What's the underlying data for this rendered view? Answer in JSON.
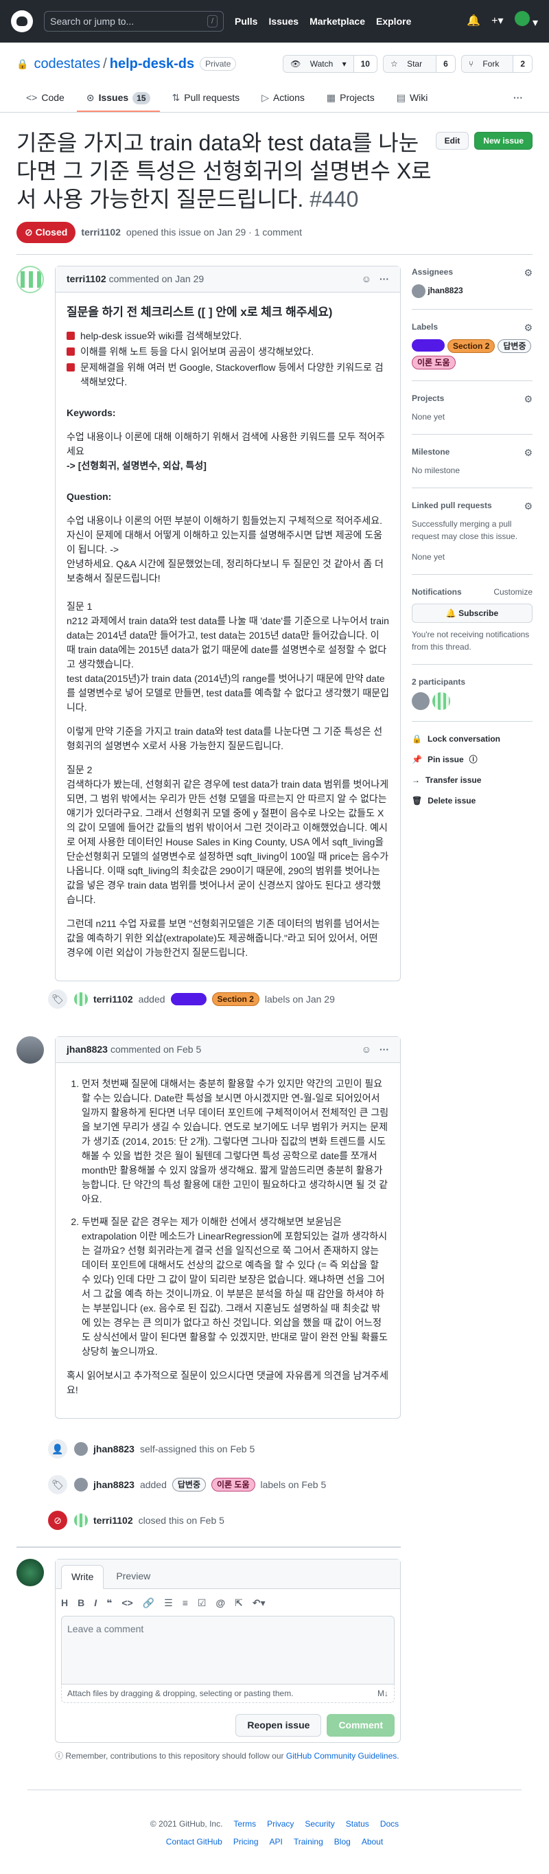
{
  "header": {
    "search_placeholder": "Search or jump to...",
    "slash": "/",
    "nav": [
      "Pulls",
      "Issues",
      "Marketplace",
      "Explore"
    ]
  },
  "repo": {
    "owner": "codestates",
    "sep": "/",
    "name": "help-desk-ds",
    "visibility": "Private",
    "watch_label": "Watch",
    "watch_count": "10",
    "star_label": "Star",
    "star_count": "6",
    "fork_label": "Fork",
    "fork_count": "2"
  },
  "tabs": [
    {
      "label": "Code"
    },
    {
      "label": "Issues",
      "count": "15"
    },
    {
      "label": "Pull requests"
    },
    {
      "label": "Actions"
    },
    {
      "label": "Projects"
    },
    {
      "label": "Wiki"
    }
  ],
  "issue": {
    "title": "기준을 가지고 train data와 test data를 나눈다면 그 기준 특성은 선형회귀의 설명변수 X로서 사용 가능한지 질문드립니다.",
    "number": "#440",
    "edit": "Edit",
    "new_issue": "New issue",
    "state": "Closed",
    "author": "terri1102",
    "meta": "opened this issue on Jan 29 · 1 comment"
  },
  "comment1": {
    "author": "terri1102",
    "date": "commented on Jan 29",
    "heading": "질문을 하기 전 체크리스트 ([ ] 안에 x로 체크 해주세요)",
    "checks": [
      "help-desk issue와 wiki를 검색해보았다.",
      "이해를 위해 노트 등을 다시 읽어보며 곰곰이 생각해보았다.",
      "문제해결을 위해 여러 번 Google, Stackoverflow 등에서 다양한 키워드로 검색해보았다."
    ],
    "kw_title": "Keywords:",
    "kw_desc": "수업 내용이나 이론에 대해 이해하기 위해서 검색에 사용한 키워드를 모두 적어주세요",
    "kw_list": "-> [선형회귀, 설명변수, 외삽, 특성]",
    "q_title": "Question:",
    "q_intro": "수업 내용이나 이론의 어떤 부분이 이해하기 힘들었는지 구체적으로 적어주세요. 자신이 문제에 대해서 어떻게 이해하고 있는지를 설명해주시면 답변 제공에 도움이 됩니다. ->",
    "q_greet": "안녕하세요. Q&A 시간에 질문했었는데, 정리하다보니 두 질문인 것 같아서 좀 더 보충해서 질문드립니다!",
    "q1_title": "질문 1",
    "q1_a": "n212 과제에서 train data와 test data를 나눌 때 'date'를 기준으로 나누어서 train data는 2014년 data만 들어가고, test data는 2015년 data만 들어갔습니다. 이 때 train data에는 2015년 data가 없기 때문에 date를 설명변수로 설정할 수 없다고 생각했습니다.",
    "q1_b": "test data(2015년)가 train data (2014년)의 range를 벗어나기 때문에 만약 date를 설명변수로 넣어 모델로 만들면, test data를 예측할 수 없다고 생각했기 때문입니다.",
    "q1_c": "이렇게 만약 기준을 가지고 train data와 test data를 나눈다면 그 기준 특성은 선형회귀의 설명변수 X로서 사용 가능한지 질문드립니다.",
    "q2_title": "질문 2",
    "q2_a": "검색하다가 봤는데, 선형회귀 같은 경우에 test data가 train data 범위를 벗어나게 되면, 그 범위 밖에서는 우리가 만든 선형 모델을 따르는지 안 따르지 알 수 없다는 얘기가 있더라구요. 그래서 선형회귀 모델 중에 y 절편이 음수로 나오는 값들도 X의 값이 모델에 들어간 값들의 범위 밖이어서 그런 것이라고 이해했었습니다. 예시로 어제 사용한 데이터인 House Sales in King County, USA 에서 sqft_living을 단순선형회귀 모델의 설명변수로 설정하면 sqft_living이 100일 때 price는 음수가 나옵니다. 이때 sqft_living의 최솟값은 290이기 때문에, 290의 범위를 벗어나는 값을 넣은 경우 train data 범위를 벗어나서 굳이 신경쓰지 않아도 된다고 생각했습니다.",
    "q2_b": "그런데 n211 수업 자료를 보면 \"선형회귀모델은 기존 데이터의 범위를 넘어서는 값을 예측하기 위한 외삽(extrapolate)도 제공해줍니다.\"라고 되어 있어서, 어떤 경우에 이런 외삽이 가능한건지 질문드립니다."
  },
  "event1": {
    "actor": "terri1102",
    "verb": "added",
    "suffix": "labels on Jan 29"
  },
  "comment2": {
    "author": "jhan8823",
    "date": "commented on Feb 5",
    "item1": "먼저 첫번째 질문에 대해서는 충분히 활용할 수가 있지만 약간의 고민이 필요할 수는 있습니다. Date란 특성을 보시면 아시겠지만 연-월-일로 되어있어서 일까지 활용하게 된다면 너무 데이터 포인트에 구체적이어서 전체적인 큰 그림을 보기엔 무리가 생길 수 있습니다. 연도로 보기에도 너무 범위가 커지는 문제가 생기죠 (2014, 2015: 단 2개). 그렇다면 그나마 집값의 변화 트렌드를 시도해볼 수 있을 법한 것은 월이 될텐데 그렇다면 특성 공학으로 date를 쪼개서 month만 활용해볼 수 있지 않을까 생각해요. 짧게 말씀드리면 충분히 활용가능합니다. 단 약간의 특성 활용에 대한 고민이 필요하다고 생각하시면 될 것 같아요.",
    "item2": "두번째 질문 같은 경우는 제가 이해한 선에서 생각해보면 보윤님은 extrapolation 이란 메소드가 LinearRegression에 포함되있는 걸까 생각하시는 걸까요? 선형 회귀라는게 결국 선을 일직선으로 쭉 그어서 존재하지 않는 데이터 포인트에 대해서도 선상의 값으로 예측을 할 수 있다 (= 즉 외삽을 할 수 있다) 인데 다만 그 값이 말이 되리란 보장은 없습니다. 왜냐하면 선을 그어서 그 값을 예측 하는 것이니까요. 이 부분은 분석을 하실 때 감안을 하셔야 하는 부분입니다 (ex. 음수로 된 집값). 그래서 지훈님도 설명하실 때 최솟값 밖에 있는 경우는 큰 의미가 없다고 하신 것입니다. 외삽을 했을 때 값이 어느정도 상식선에서 말이 된다면 활용할 수 있겠지만, 반대로 말이 완전 안될 확률도 상당히 높으니까요.",
    "closing": "혹시 읽어보시고 추가적으로 질문이 있으시다면 댓글에 자유롭게 의견을 남겨주세요!"
  },
  "event2": {
    "actor": "jhan8823",
    "text": "self-assigned this on Feb 5"
  },
  "event3": {
    "actor": "jhan8823",
    "verb": "added",
    "suffix": "labels on Feb 5"
  },
  "event4": {
    "actor": "terri1102",
    "text": "closed this on Feb 5"
  },
  "labels": [
    {
      "name": "",
      "bg": "#5319e7",
      "fg": "#ffffff"
    },
    {
      "name": "Section 2",
      "bg": "#f29d49",
      "fg": "#3d1d00"
    },
    {
      "name": "답변중",
      "bg": "#f6f8fa",
      "fg": "#24292f"
    },
    {
      "name": "이론 도움",
      "bg": "#f7b7d2",
      "fg": "#5a0a2c"
    }
  ],
  "editor": {
    "tab_write": "Write",
    "tab_preview": "Preview",
    "placeholder": "Leave a comment",
    "attach": "Attach files by dragging & dropping, selecting or pasting them.",
    "reopen": "Reopen issue",
    "comment": "Comment",
    "note_prefix": "Remember, contributions to this repository should follow our",
    "note_link": "GitHub Community Guidelines",
    "note_suffix": "."
  },
  "sidebar": {
    "assignees_title": "Assignees",
    "assignee": "jhan8823",
    "labels_title": "Labels",
    "projects_title": "Projects",
    "projects_val": "None yet",
    "milestone_title": "Milestone",
    "milestone_val": "No milestone",
    "linked_title": "Linked pull requests",
    "linked_desc": "Successfully merging a pull request may close this issue.",
    "linked_val": "None yet",
    "notif_title": "Notifications",
    "customize": "Customize",
    "subscribe": "Subscribe",
    "notif_desc": "You're not receiving notifications from this thread.",
    "participants": "2 participants",
    "lock": "Lock conversation",
    "pin": "Pin issue",
    "transfer": "Transfer issue",
    "delete": "Delete issue"
  },
  "footer": {
    "copyright": "© 2021 GitHub, Inc.",
    "row1": [
      "Terms",
      "Privacy",
      "Security",
      "Status",
      "Docs"
    ],
    "row2": [
      "Contact GitHub",
      "Pricing",
      "API",
      "Training",
      "Blog",
      "About"
    ]
  }
}
